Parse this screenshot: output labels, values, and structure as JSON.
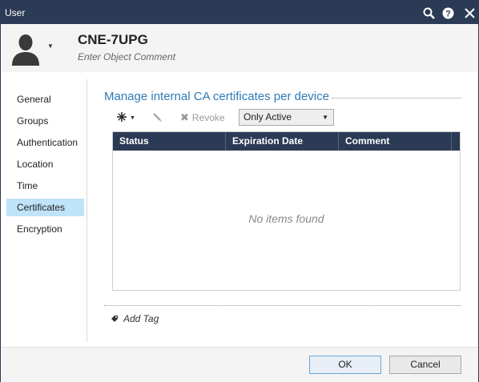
{
  "window": {
    "title": "User",
    "icons": [
      "search-icon",
      "help-icon",
      "close-icon"
    ]
  },
  "header": {
    "object_name": "CNE-7UPG",
    "comment_placeholder": "Enter Object Comment",
    "avatar_icon": "user-avatar-icon"
  },
  "sidebar": {
    "items": [
      {
        "label": "General",
        "active": false
      },
      {
        "label": "Groups",
        "active": false
      },
      {
        "label": "Authentication",
        "active": false
      },
      {
        "label": "Location",
        "active": false
      },
      {
        "label": "Time",
        "active": false
      },
      {
        "label": "Certificates",
        "active": true
      },
      {
        "label": "Encryption",
        "active": false
      }
    ]
  },
  "main": {
    "section_title": "Manage internal CA certificates per device",
    "toolbar": {
      "new_icon": "new-star-icon",
      "edit_icon": "pencil-icon",
      "revoke_label": "Revoke",
      "filter_value": "Only Active"
    },
    "table": {
      "columns": [
        "Status",
        "Expiration Date",
        "Comment"
      ],
      "rows": [],
      "empty_message": "No items found"
    },
    "add_tag_label": "Add Tag"
  },
  "footer": {
    "ok_label": "OK",
    "cancel_label": "Cancel"
  },
  "colors": {
    "titlebar": "#2b3a55",
    "accent": "#2f7ab5",
    "active_nav": "#bfe3f8"
  }
}
